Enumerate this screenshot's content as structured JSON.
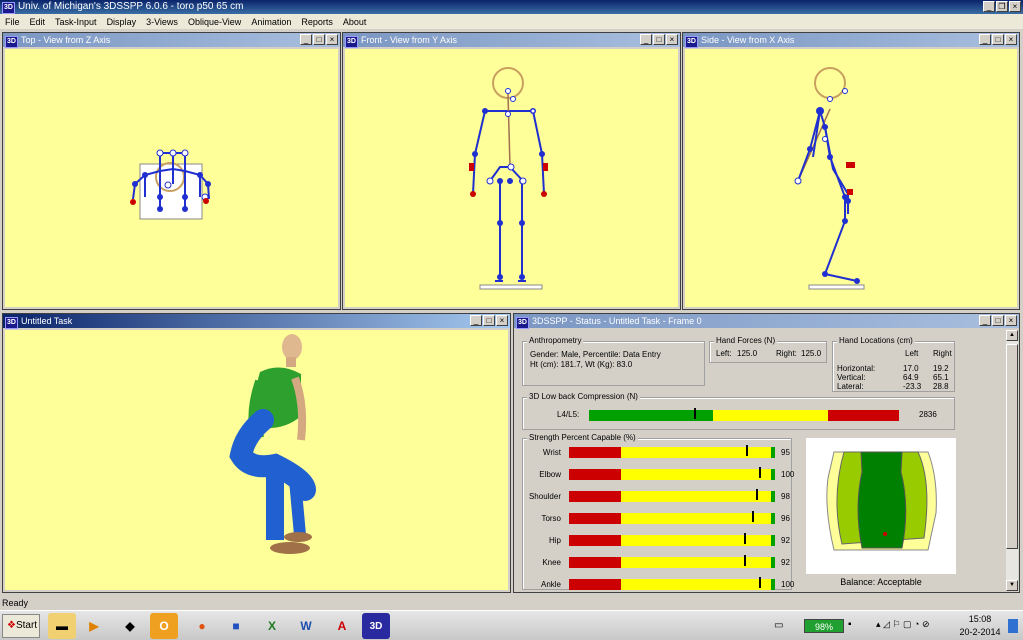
{
  "app": {
    "title": "Univ. of Michigan's 3DSSPP 6.0.6 - toro p50 65 cm",
    "icon": "3D"
  },
  "menu": [
    "File",
    "Edit",
    "Task-Input",
    "Display",
    "3-Views",
    "Oblique-View",
    "Animation",
    "Reports",
    "About"
  ],
  "windows": {
    "top": {
      "icon": "3D",
      "title": "Top - View from Z Axis"
    },
    "front": {
      "icon": "3D",
      "title": "Front - View from Y Axis"
    },
    "side": {
      "icon": "3D",
      "title": "Side - View from X Axis"
    },
    "task": {
      "icon": "3D",
      "title": "Untitled Task"
    },
    "status": {
      "icon": "3D",
      "title": "3DSSPP - Status - Untitled Task - Frame 0"
    }
  },
  "status": {
    "anthro": {
      "label": "Anthropometry",
      "line1": "Gender: Male, Percentile: Data Entry",
      "line2": "Ht (cm): 181.7, Wt (Kg): 83.0"
    },
    "hand_forces": {
      "label": "Hand Forces (N)",
      "left_label": "Left:",
      "left": "125.0",
      "right_label": "Right:",
      "right": "125.0"
    },
    "hand_loc": {
      "label": "Hand Locations (cm)",
      "col_left": "Left",
      "col_right": "Right",
      "rows": [
        {
          "name": "Horizontal:",
          "left": "17.0",
          "right": "19.2"
        },
        {
          "name": "Vertical:",
          "left": "64.9",
          "right": "65.1"
        },
        {
          "name": "Lateral:",
          "left": "-23.3",
          "right": "28.8"
        }
      ]
    },
    "lowback": {
      "label": "3D Low back Compression (N)",
      "row_label": "L4/L5:",
      "value": "2836",
      "fraction": 0.34
    },
    "strength": {
      "label": "Strength Percent Capable (%)",
      "rows": [
        {
          "name": "Wrist",
          "value": "95"
        },
        {
          "name": "Elbow",
          "value": "100"
        },
        {
          "name": "Shoulder",
          "value": "98"
        },
        {
          "name": "Torso",
          "value": "96"
        },
        {
          "name": "Hip",
          "value": "92"
        },
        {
          "name": "Knee",
          "value": "92"
        },
        {
          "name": "Ankle",
          "value": "100"
        }
      ]
    },
    "balance": "Balance: Acceptable"
  },
  "statusbar": "Ready",
  "taskbar": {
    "start": "Start",
    "battery": "98%",
    "time": "15:08",
    "date": "20-2-2014"
  },
  "colors": {
    "viewport": "#ffff99",
    "red": "#cc0000",
    "yellow": "#ffff00",
    "green": "#00a000",
    "skeleton": "#1f2fd0"
  }
}
